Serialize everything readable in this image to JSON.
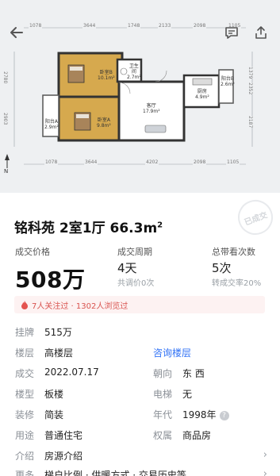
{
  "floor_plan": {
    "top_dims": [
      "1078",
      "3644",
      "1748",
      "2133",
      "2098",
      "1105"
    ],
    "bottom_dims": [
      "1078",
      "3644",
      "4202",
      "2098",
      "1105"
    ],
    "left_dims": [
      "2780",
      "2903"
    ],
    "right_dims": [
      "1379",
      "2352",
      "2187"
    ],
    "rooms": [
      {
        "name": "卧室B",
        "area": "10.1m²"
      },
      {
        "name": "卫生间",
        "area": "2.7m²"
      },
      {
        "name": "阳台A",
        "area": "2.9m²"
      },
      {
        "name": "卧室A",
        "area": "9.8m²"
      },
      {
        "name": "客厅",
        "area": "17.9m²"
      },
      {
        "name": "厨房",
        "area": "4.9m²"
      },
      {
        "name": "阳台B",
        "area": "2.6m²"
      }
    ],
    "compass": "N"
  },
  "colors": {
    "accent": "#3072f6",
    "alert": "#d9534f",
    "bedroom": "#d6a94e",
    "room": "#ffffff"
  },
  "listing": {
    "title": "铭科苑 2室1厅 66.3m",
    "title_sup": "2",
    "stamp": "已成交",
    "price_label": "成交价格",
    "price": "508万",
    "period_label": "成交周期",
    "period": "4天",
    "period_sub": "共调价0次",
    "visits_label": "总带看次数",
    "visits": "5次",
    "visits_sub": "转成交率20%",
    "alert": "7人关注过 · 1302人浏览过",
    "details": [
      {
        "label": "挂牌",
        "value": "515万"
      },
      {
        "label": "楼层",
        "value": "高楼层",
        "label2": "",
        "value2": "咨询楼层"
      },
      {
        "label": "成交",
        "value": "2022.07.17",
        "label2": "朝向",
        "value2": "东 西"
      },
      {
        "label": "楼型",
        "value": "板楼",
        "label2": "电梯",
        "value2": "无"
      },
      {
        "label": "装修",
        "value": "简装",
        "label2": "年代",
        "value2": "1998年"
      },
      {
        "label": "用途",
        "value": "普通住宅",
        "label2": "权属",
        "value2": "商品房"
      },
      {
        "label": "介绍",
        "value": "房源介绍"
      },
      {
        "label": "更多",
        "value": "梯户比例 · 供暖方式 · 交易历史等"
      }
    ]
  }
}
